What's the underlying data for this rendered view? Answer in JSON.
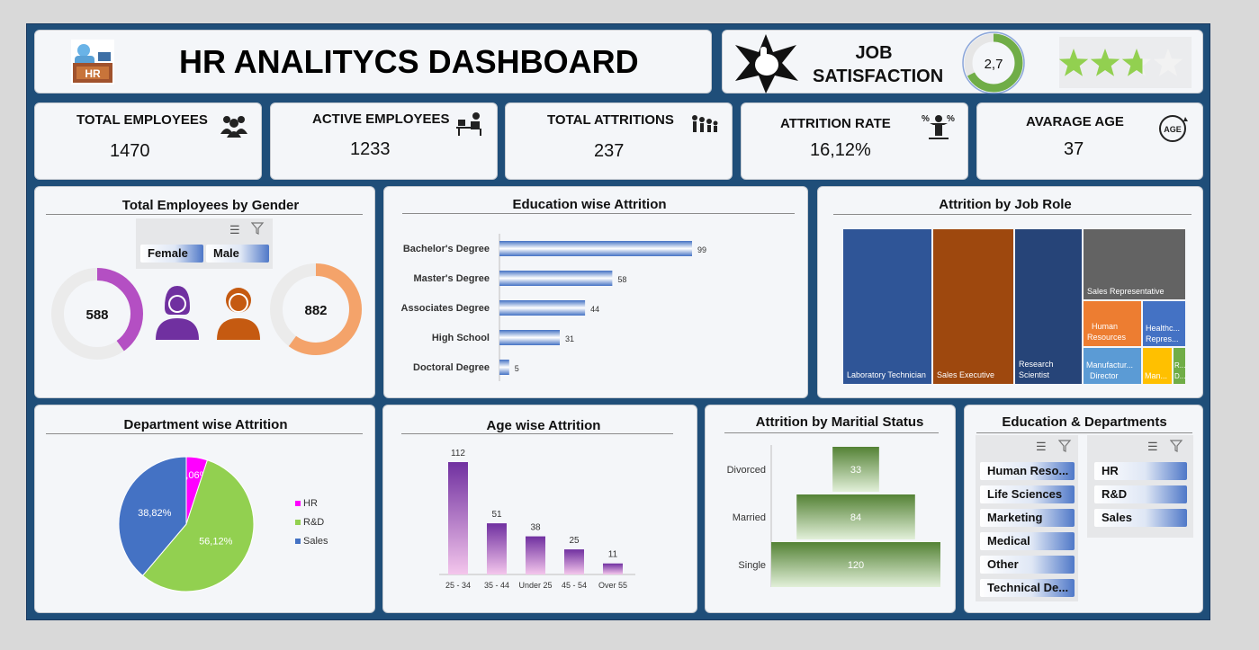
{
  "header": {
    "title": "HR ANALITYCS DASHBOARD",
    "badge_text": "HR",
    "job_satisfaction_label_1": "JOB",
    "job_satisfaction_label_2": "SATISFACTION",
    "job_satisfaction_value": "2,7",
    "job_satisfaction_fraction": 0.675,
    "stars_rating": 2.7,
    "stars_max": 4
  },
  "kpis": [
    {
      "label": "TOTAL EMPLOYEES",
      "value": "1470",
      "icon": "people-group-icon"
    },
    {
      "label": "ACTIVE EMPLOYEES",
      "value": "1233",
      "icon": "desk-worker-icon"
    },
    {
      "label": "TOTAL ATTRITIONS",
      "value": "237",
      "icon": "attrition-group-icon"
    },
    {
      "label": "ATTRITION RATE",
      "value": "16,12%",
      "icon": "percent-person-icon"
    },
    {
      "label": "AVARAGE AGE",
      "value": "37",
      "icon": "age-icon"
    }
  ],
  "gender": {
    "title": "Total Employees by Gender",
    "slicer": [
      "Female",
      "Male"
    ],
    "female_value": "588",
    "male_value": "882",
    "female_fraction": 0.4,
    "male_fraction": 0.6,
    "colors": {
      "female": "#7030a0",
      "male": "#e46c0a"
    }
  },
  "education_attrition": {
    "title": "Education wise Attrition",
    "chart_data": {
      "type": "bar",
      "orientation": "horizontal",
      "categories": [
        "Bachelor's Degree",
        "Master's Degree",
        "Associates Degree",
        "High School",
        "Doctoral Degree"
      ],
      "values": [
        99,
        58,
        44,
        31,
        5
      ]
    }
  },
  "job_role": {
    "title": "Attrition by Job Role",
    "labels": {
      "lab": "Laboratory Technician",
      "sales_exec": "Sales Executive",
      "research_1": "Research",
      "research_2": "Scientist",
      "sales_rep": "Sales Representative",
      "hr_1": "Human",
      "hr_2": "Resources",
      "health_1": "Healthc...",
      "health_2": "Repres...",
      "manuf_1": "Manufactur...",
      "manuf_2": "Director",
      "manager": "Man...",
      "rd_1": "R...",
      "rd_2": "D..."
    },
    "colors": {
      "lab": "#2f5597",
      "sales_exec": "#9e480e",
      "research": "#264478",
      "sales_rep": "#636363",
      "hr": "#ed7d31",
      "health": "#4472c4",
      "manuf": "#5b9bd5",
      "manager": "#ffc000",
      "rd": "#70ad47"
    }
  },
  "department": {
    "title": "Department wise Attrition",
    "chart_data": {
      "type": "pie",
      "categories": [
        "HR",
        "R&D",
        "Sales"
      ],
      "values": [
        5.06,
        56.12,
        38.82
      ],
      "labels": [
        "5,06%",
        "56,12%",
        "38,82%"
      ],
      "colors": [
        "#ff00ff",
        "#92d050",
        "#4472c4"
      ]
    }
  },
  "age": {
    "title": "Age wise Attrition",
    "chart_data": {
      "type": "bar",
      "categories": [
        "25 - 34",
        "35 - 44",
        "Under 25",
        "45 - 54",
        "Over 55"
      ],
      "values": [
        112,
        51,
        38,
        25,
        11
      ]
    }
  },
  "marital": {
    "title": "Attrition by Maritial Status",
    "chart_data": {
      "type": "bar",
      "orientation": "horizontal-centered",
      "categories": [
        "Divorced",
        "Married",
        "Single"
      ],
      "values": [
        33,
        84,
        120
      ]
    }
  },
  "edu_dept": {
    "title": "Education & Departments",
    "education_items": [
      "Human Reso...",
      "Life Sciences",
      "Marketing",
      "Medical",
      "Other",
      "Technical De..."
    ],
    "department_items": [
      "HR",
      "R&D",
      "Sales"
    ]
  }
}
